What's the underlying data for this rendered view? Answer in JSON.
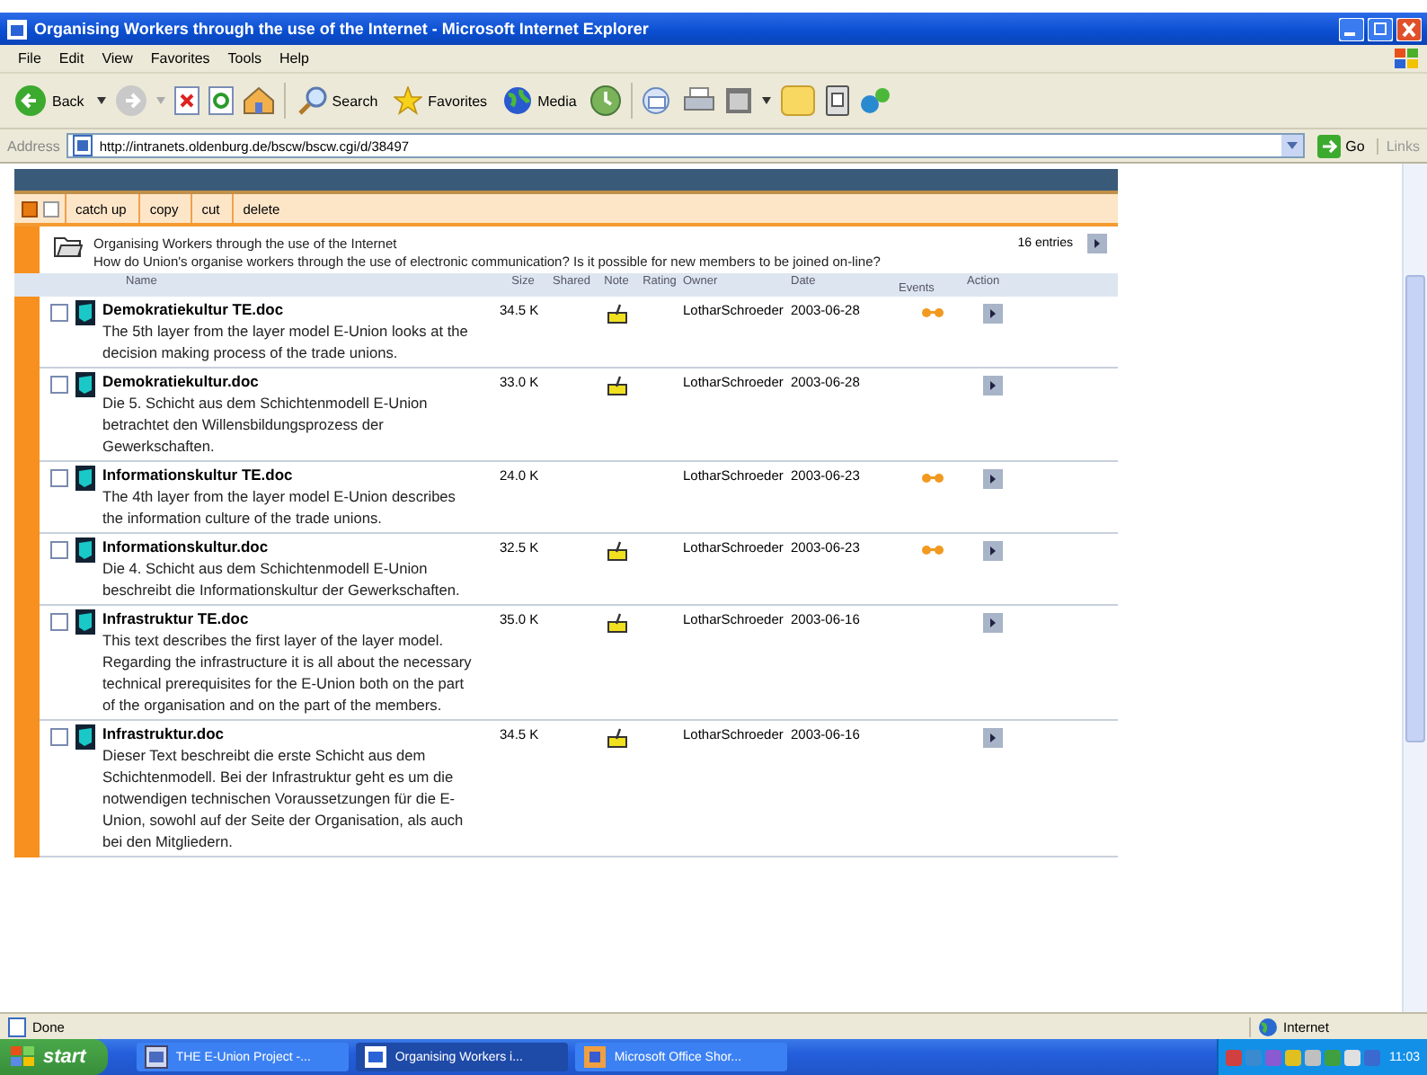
{
  "window": {
    "title": "Organising Workers through the use of the Internet - Microsoft Internet Explorer"
  },
  "menu": [
    "File",
    "Edit",
    "View",
    "Favorites",
    "Tools",
    "Help"
  ],
  "toolbar": {
    "back": "Back",
    "search": "Search",
    "favorites": "Favorites",
    "media": "Media"
  },
  "address": {
    "label": "Address",
    "url": "http://intranets.oldenburg.de/bscw/bscw.cgi/d/38497",
    "go": "Go",
    "links": "Links"
  },
  "actions": [
    "catch up",
    "copy",
    "cut",
    "delete"
  ],
  "folder": {
    "title": "Organising Workers through the use of the Internet",
    "entries": "16 entries",
    "description": "How do Union's organise workers through the use of electronic communication? Is it possible for new members to be joined on-line?"
  },
  "columns": [
    "Name",
    "Size",
    "Shared",
    "Note",
    "Rating",
    "Owner",
    "Date",
    "Events",
    "Action"
  ],
  "rows": [
    {
      "name": "Demokratiekultur TE.doc",
      "description": "The 5th layer from the layer model E-Union looks at the decision making process of the trade unions.",
      "size": "34.5 K",
      "note": true,
      "owner": "LotharSchroeder",
      "date": "2003-06-28",
      "events": true,
      "checked": false
    },
    {
      "name": "Demokratiekultur.doc",
      "description": "Die 5. Schicht aus dem Schichtenmodell E-Union betrachtet den Willensbildungsprozess der Gewerkschaften.",
      "size": "33.0 K",
      "note": true,
      "owner": "LotharSchroeder",
      "date": "2003-06-28",
      "events": false,
      "checked": false
    },
    {
      "name": "Informationskultur TE.doc",
      "description": "The 4th layer from the layer model E-Union describes the information culture of the trade unions.",
      "size": "24.0 K",
      "note": false,
      "owner": "LotharSchroeder",
      "date": "2003-06-23",
      "events": true,
      "checked": false
    },
    {
      "name": "Informationskultur.doc",
      "description": "Die 4. Schicht aus dem Schichtenmodell E-Union beschreibt die Informationskultur der Gewerkschaften.",
      "size": "32.5 K",
      "note": true,
      "owner": "LotharSchroeder",
      "date": "2003-06-23",
      "events": true,
      "checked": false
    },
    {
      "name": "Infrastruktur TE.doc",
      "description": "This text describes the first layer of the layer model. Regarding the infrastructure it is all about the necessary technical prerequisites for the E-Union both on the part of the organisation and on the part of the members.",
      "size": "35.0 K",
      "note": true,
      "owner": "LotharSchroeder",
      "date": "2003-06-16",
      "events": false,
      "checked": false
    },
    {
      "name": "Infrastruktur.doc",
      "description": "Dieser Text beschreibt die erste Schicht aus dem Schichtenmodell. Bei der Infrastruktur geht es um die notwendigen technischen Voraussetzungen für die E-Union, sowohl auf der Seite der Organisation, als auch bei den Mitgliedern.",
      "size": "34.5 K",
      "note": true,
      "owner": "LotharSchroeder",
      "date": "2003-06-16",
      "events": false,
      "checked": false
    }
  ],
  "status_bar": {
    "text": "Done",
    "zone": "Internet"
  },
  "taskbar": {
    "start": "start",
    "tasks": [
      {
        "label": "THE E-Union Project -...",
        "selected": false
      },
      {
        "label": "Organising Workers i...",
        "selected": true
      },
      {
        "label": "Microsoft Office Shor...",
        "selected": false
      }
    ],
    "clock": "11:03"
  }
}
